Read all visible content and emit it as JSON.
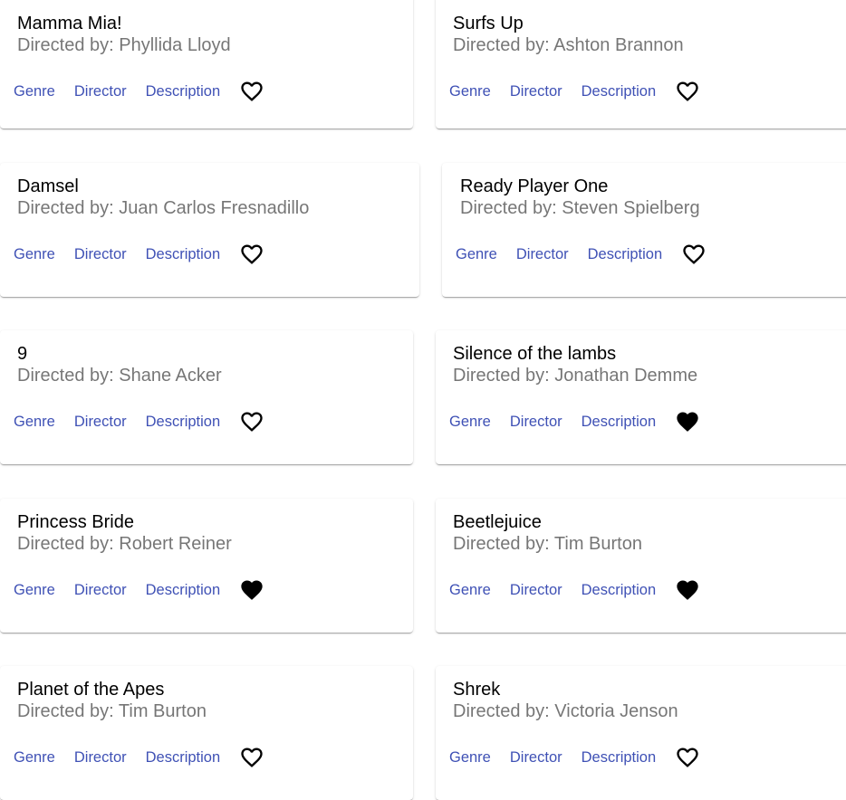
{
  "cards": [
    {
      "title": "Mamma Mia!",
      "director": "Directed by: Phyllida Lloyd",
      "genre": "Genre",
      "director_btn": "Director",
      "description": "Description",
      "favorite": false
    },
    {
      "title": "Surfs Up",
      "director": "Directed by: Ashton Brannon",
      "genre": "Genre",
      "director_btn": "Director",
      "description": "Description",
      "favorite": false
    },
    {
      "title": "Damsel",
      "director": "Directed by: Juan Carlos Fresnadillo",
      "genre": "Genre",
      "director_btn": "Director",
      "description": "Description",
      "favorite": false
    },
    {
      "title": "Ready Player One",
      "director": "Directed by: Steven Spielberg",
      "genre": "Genre",
      "director_btn": "Director",
      "description": "Description",
      "favorite": false
    },
    {
      "title": "9",
      "director": "Directed by: Shane Acker",
      "genre": "Genre",
      "director_btn": "Director",
      "description": "Description",
      "favorite": false
    },
    {
      "title": "Silence of the lambs",
      "director": "Directed by: Jonathan Demme",
      "genre": "Genre",
      "director_btn": "Director",
      "description": "Description",
      "favorite": true
    },
    {
      "title": "Princess Bride",
      "director": "Directed by: Robert Reiner",
      "genre": "Genre",
      "director_btn": "Director",
      "description": "Description",
      "favorite": true
    },
    {
      "title": "Beetlejuice",
      "director": "Directed by: Tim Burton",
      "genre": "Genre",
      "director_btn": "Director",
      "description": "Description",
      "favorite": true
    },
    {
      "title": "Planet of the Apes",
      "director": "Directed by: Tim Burton",
      "genre": "Genre",
      "director_btn": "Director",
      "description": "Description",
      "favorite": false
    },
    {
      "title": "Shrek",
      "director": "Directed by: Victoria Jenson",
      "genre": "Genre",
      "director_btn": "Director",
      "description": "Description",
      "favorite": false
    }
  ],
  "icons": {
    "favorite_empty": "heart-outline-icon",
    "favorite_filled": "heart-filled-icon"
  },
  "colors": {
    "link": "#3f51b5",
    "subtitle": "#757575",
    "title": "#000000"
  }
}
